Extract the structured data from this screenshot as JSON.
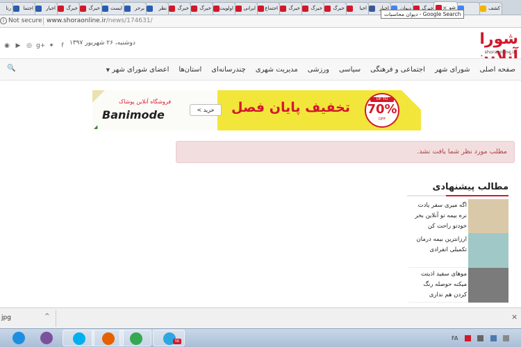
{
  "browser": {
    "tabs": [
      {
        "label": "کشف",
        "icon_color": "#f4b400"
      },
      {
        "label": "",
        "icon_color": "#4285f4"
      },
      {
        "label": "شو",
        "icon_color": "#d2182b",
        "active": true
      },
      {
        "label": "خبرگ",
        "icon_color": "#d2182b"
      },
      {
        "label": "دیوان",
        "icon_color": "#4285f4"
      },
      {
        "label": "اخبار",
        "icon_color": "#3b5998"
      },
      {
        "label": "اخبا",
        "icon_color": "#d2182b"
      },
      {
        "label": "خبرگ",
        "icon_color": "#d2182b"
      },
      {
        "label": "خبرگ",
        "icon_color": "#d2182b"
      },
      {
        "label": "خبرگ",
        "icon_color": "#d2182b"
      },
      {
        "label": "اجتماع",
        "icon_color": "#d2182b"
      },
      {
        "label": "ایرانی",
        "icon_color": "#d2182b"
      },
      {
        "label": "اولویت",
        "icon_color": "#d2182b"
      },
      {
        "label": "خبرگ",
        "icon_color": "#d2182b"
      },
      {
        "label": "خبرگ",
        "icon_color": "#d2182b"
      },
      {
        "label": "نظر",
        "icon_color": "#2a5db0"
      },
      {
        "label": "برخر",
        "icon_color": "#2a5db0"
      },
      {
        "label": "ایست",
        "icon_color": "#2a5db0"
      },
      {
        "label": "خبرگ",
        "icon_color": "#d2182b"
      },
      {
        "label": "خبرگ",
        "icon_color": "#d2182b"
      },
      {
        "label": "اخبار",
        "icon_color": "#2a5db0"
      },
      {
        "label": "اجتما",
        "icon_color": "#2a5db0"
      },
      {
        "label": "رنا",
        "icon_color": "#2a5db0"
      }
    ],
    "tab_close": "×",
    "tooltip": "Google Search - دیوان محاسبات",
    "security_icon_glyph": "i",
    "security_label": "Not secure",
    "url_host": "www.shoraonline.ir",
    "url_path": "/news/174631/"
  },
  "header": {
    "date": "دوشنبه، ۲۶ شهریور ۱۳۹۷",
    "logo_text": "شورا آنلاین",
    "logo_domain": "shoraonline.ir",
    "social_icons": [
      {
        "name": "rss-icon",
        "glyph": "◉"
      },
      {
        "name": "youtube-icon",
        "glyph": "▶"
      },
      {
        "name": "instagram-icon",
        "glyph": "◎"
      },
      {
        "name": "google-plus-icon",
        "glyph": "g+"
      },
      {
        "name": "twitter-icon",
        "glyph": "✦"
      },
      {
        "name": "facebook-icon",
        "glyph": "f"
      }
    ]
  },
  "nav": {
    "items": [
      "صفحه اصلی",
      "شورای شهر",
      "اجتماعی و فرهنگی",
      "سیاسی",
      "ورزشی",
      "مدیریت شهری",
      "چندرسانه‌ای",
      "استان‌ها",
      "اعضای شورای شهر"
    ],
    "dropdown_caret": "▼",
    "search_glyph": "🔍"
  },
  "banner": {
    "shop_label": "فروشگاه آنلاین پوشاک",
    "brand": "Banimode",
    "buy_button": "خرید >",
    "sale_text": "تخفیف پایان فصل",
    "badge_top": "UP TO",
    "badge_percent": "70%",
    "badge_bottom": "OFF",
    "corner_mark": "◢",
    "colors": {
      "bg": "#f3e63a",
      "accent": "#d2182b"
    }
  },
  "alert": {
    "message": "مطلب مورد نظر شما یافت نشد."
  },
  "suggested": {
    "title": "مطالب پیشنهادی",
    "items": [
      {
        "text": "اگه میری سفر یادت نره بیمه تو آنلاین بخر خودتو راحت کن",
        "thumb": "#d9c9a9"
      },
      {
        "text": "ارزانترین بیمه درمان تکمیلی انفرادی",
        "thumb": "#9fc8c6"
      },
      {
        "text": "موهای سفید اذیتت میکنه حوصله رنگ کردن هم نداری",
        "thumb": "#7b7b7b"
      }
    ]
  },
  "downloads": {
    "filename": "jpg",
    "chevron": "^",
    "close_glyph": "×"
  },
  "taskbar": {
    "apps": [
      {
        "name": "internet-explorer-icon",
        "color": "#1d8fe0"
      },
      {
        "name": "viber-icon",
        "color": "#7b519d"
      },
      {
        "name": "skype-icon",
        "color": "#00aff0"
      },
      {
        "name": "firefox-icon",
        "color": "#e66000"
      },
      {
        "name": "chrome-icon",
        "color": "#34a853"
      },
      {
        "name": "telegram-icon",
        "color": "#2ca5e0"
      }
    ],
    "telegram_badge": "56",
    "language": "FA"
  }
}
